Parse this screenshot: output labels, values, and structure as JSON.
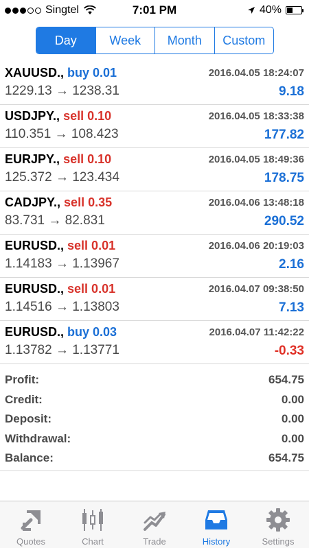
{
  "status_bar": {
    "carrier": "Singtel",
    "time": "7:01 PM",
    "battery": "40%",
    "signal_strength": 3,
    "battery_level": 0.4
  },
  "segmented": {
    "options": [
      "Day",
      "Week",
      "Month",
      "Custom"
    ],
    "selected": "Day"
  },
  "trades": [
    {
      "symbol": "XAUUSD.,",
      "action": "buy 0.01",
      "action_type": "buy",
      "time": "2016.04.05 18:24:07",
      "prices": "1229.13 → 1238.31",
      "profit": "9.18",
      "profit_sign": "pos"
    },
    {
      "symbol": "USDJPY.,",
      "action": "sell 0.10",
      "action_type": "sell",
      "time": "2016.04.05 18:33:38",
      "prices": "110.351 → 108.423",
      "profit": "177.82",
      "profit_sign": "pos"
    },
    {
      "symbol": "EURJPY.,",
      "action": "sell 0.10",
      "action_type": "sell",
      "time": "2016.04.05 18:49:36",
      "prices": "125.372 → 123.434",
      "profit": "178.75",
      "profit_sign": "pos"
    },
    {
      "symbol": "CADJPY.,",
      "action": "sell 0.35",
      "action_type": "sell",
      "time": "2016.04.06 13:48:18",
      "prices": "83.731 → 82.831",
      "profit": "290.52",
      "profit_sign": "pos"
    },
    {
      "symbol": "EURUSD.,",
      "action": "sell 0.01",
      "action_type": "sell",
      "time": "2016.04.06 20:19:03",
      "prices": "1.14183 → 1.13967",
      "profit": "2.16",
      "profit_sign": "pos"
    },
    {
      "symbol": "EURUSD.,",
      "action": "sell 0.01",
      "action_type": "sell",
      "time": "2016.04.07 09:38:50",
      "prices": "1.14516 → 1.13803",
      "profit": "7.13",
      "profit_sign": "pos"
    },
    {
      "symbol": "EURUSD.,",
      "action": "buy 0.03",
      "action_type": "buy",
      "time": "2016.04.07 11:42:22",
      "prices": "1.13782 → 1.13771",
      "profit": "-0.33",
      "profit_sign": "neg"
    }
  ],
  "summary": [
    {
      "label": "Profit:",
      "value": "654.75"
    },
    {
      "label": "Credit:",
      "value": "0.00"
    },
    {
      "label": "Deposit:",
      "value": "0.00"
    },
    {
      "label": "Withdrawal:",
      "value": "0.00"
    },
    {
      "label": "Balance:",
      "value": "654.75"
    }
  ],
  "tabs": [
    {
      "label": "Quotes",
      "icon": "quotes-icon",
      "active": false
    },
    {
      "label": "Chart",
      "icon": "chart-icon",
      "active": false
    },
    {
      "label": "Trade",
      "icon": "trade-icon",
      "active": false
    },
    {
      "label": "History",
      "icon": "history-icon",
      "active": true
    },
    {
      "label": "Settings",
      "icon": "settings-icon",
      "active": false
    }
  ],
  "colors": {
    "accent": "#1f7ae3",
    "buy": "#1a6fd6",
    "sell": "#d8332b",
    "profit_positive": "#1a6fd6",
    "profit_negative": "#e03026",
    "inactive_tab": "#8e8e93"
  }
}
